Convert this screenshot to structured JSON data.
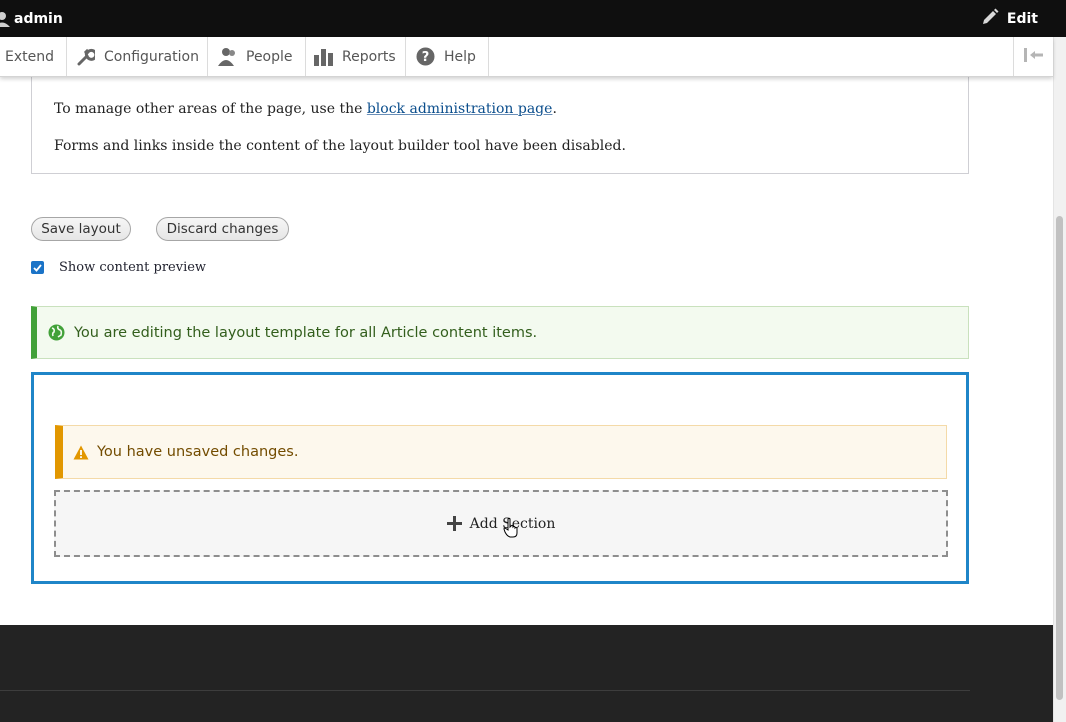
{
  "toolbar": {
    "user_label": "admin",
    "edit_label": "Edit"
  },
  "tray": {
    "items": [
      {
        "label": "Extend",
        "icon": "none"
      },
      {
        "label": "Configuration",
        "icon": "wrench-icon"
      },
      {
        "label": "People",
        "icon": "people-icon"
      },
      {
        "label": "Reports",
        "icon": "bar-chart-icon"
      },
      {
        "label": "Help",
        "icon": "help-icon"
      }
    ]
  },
  "messages": {
    "manage_prefix": "To manage other areas of the page, use the ",
    "manage_link": "block administration page",
    "manage_suffix": ".",
    "forms_disabled": "Forms and links inside the content of the layout builder tool have been disabled."
  },
  "actions": {
    "save_label": "Save layout",
    "discard_label": "Discard changes"
  },
  "preview": {
    "label": "Show content preview",
    "checked": true
  },
  "status": {
    "text": "You are editing the layout template for all Article content items."
  },
  "warning": {
    "text": "You have unsaved changes."
  },
  "layout": {
    "add_section_label": "Add Section"
  },
  "colors": {
    "accent": "#1f85c8",
    "status_green": "#42a139",
    "warning_orange": "#e29700",
    "toolbar_bg": "#0f0f0f",
    "footer_bg": "#232323"
  }
}
